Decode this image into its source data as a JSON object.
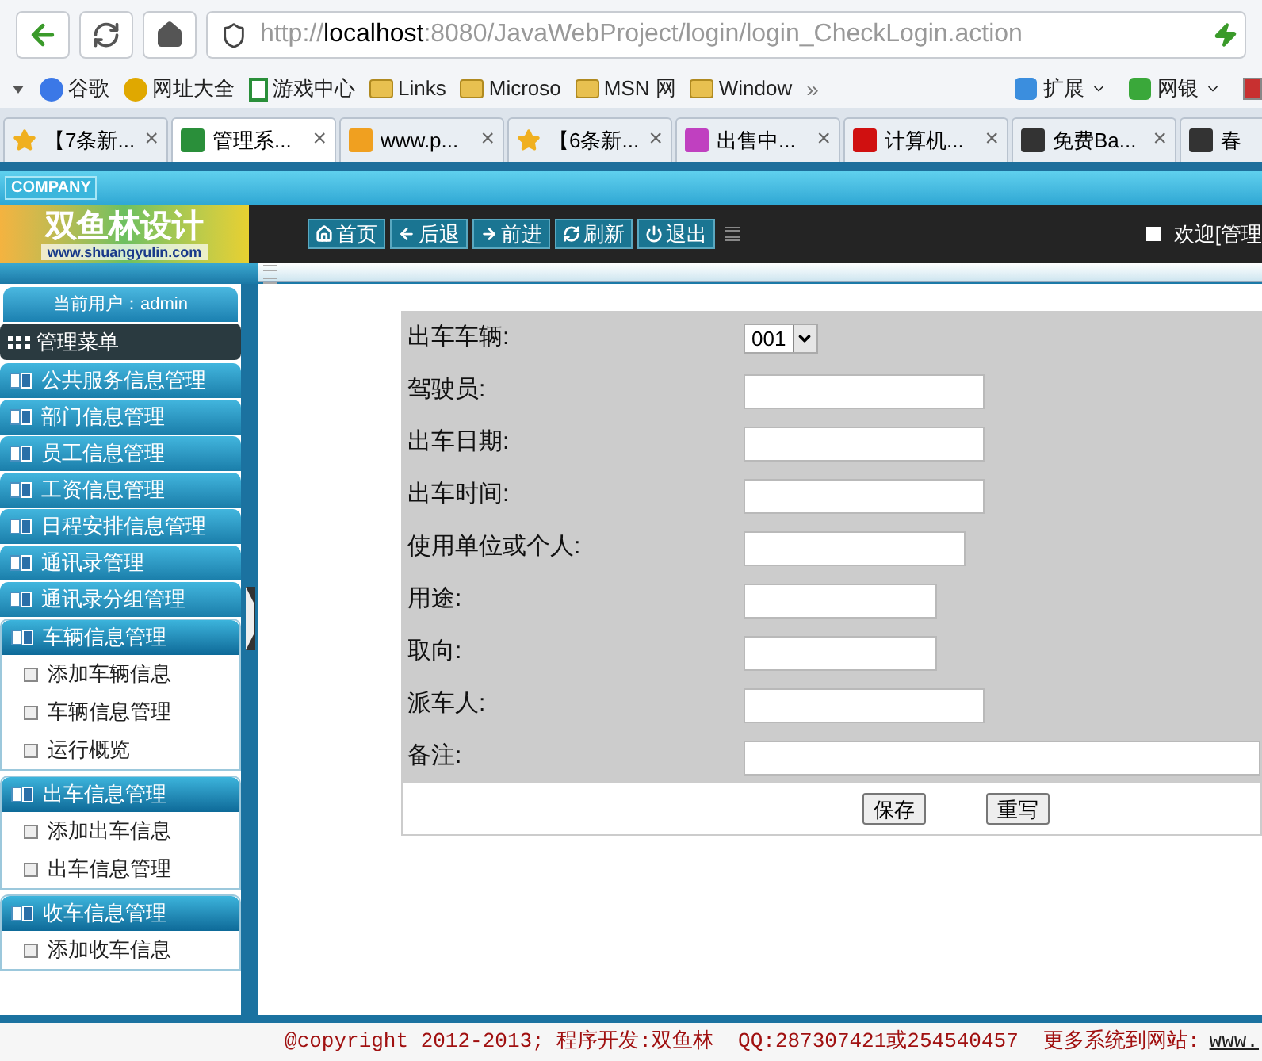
{
  "browser": {
    "address": "http://**localhost**:8080/JavaWebProject/login/login_CheckLogin.action",
    "bookmarks": [
      {
        "label": "谷歌",
        "kind": "site",
        "color": "#3b78e7"
      },
      {
        "label": "网址大全",
        "kind": "site",
        "color": "#e0a800"
      },
      {
        "label": "游戏中心",
        "kind": "page",
        "color": "#2a8f3a"
      },
      {
        "label": "Links",
        "kind": "folder",
        "color": "#e8c050"
      },
      {
        "label": "Microso",
        "kind": "folder",
        "color": "#e8c050"
      },
      {
        "label": "MSN 网",
        "kind": "folder",
        "color": "#e8c050"
      },
      {
        "label": "Window",
        "kind": "folder",
        "color": "#e8c050"
      }
    ],
    "more": "»",
    "tools": [
      {
        "label": "扩展",
        "color": "#3b8ede"
      },
      {
        "label": "网银",
        "color": "#3aa83a"
      }
    ],
    "tabs": [
      {
        "label": "【7条新...",
        "selected": false,
        "color": "#f0b020"
      },
      {
        "label": "管理系...",
        "selected": true,
        "color": "#2a8f3a"
      },
      {
        "label": "www.p...",
        "selected": false,
        "color": "#f0a020"
      },
      {
        "label": "【6条新...",
        "selected": false,
        "color": "#f0b020"
      },
      {
        "label": "出售中...",
        "selected": false,
        "color": "#c040c0"
      },
      {
        "label": "计算机...",
        "selected": false,
        "color": "#d01010"
      },
      {
        "label": "免费Ba...",
        "selected": false,
        "color": "#333333"
      },
      {
        "label": "春",
        "selected": false,
        "color": "#333333"
      }
    ],
    "close": "×"
  },
  "header": {
    "badge": "COMPANY",
    "logo_title": "双鱼林设计",
    "logo_url": "www.shuangyulin.com",
    "nav": [
      {
        "label": "首页",
        "kind": "home"
      },
      {
        "label": "后退",
        "kind": "back"
      },
      {
        "label": "前进",
        "kind": "forward"
      },
      {
        "label": "刷新",
        "kind": "refresh"
      },
      {
        "label": "退出",
        "kind": "exit"
      }
    ],
    "welcome": "欢迎[管理"
  },
  "sidebar": {
    "user": "当前用户：admin",
    "menu_title": "管理菜单",
    "groups": [
      {
        "label": "公共服务信息管理",
        "expanded": false
      },
      {
        "label": "部门信息管理",
        "expanded": false
      },
      {
        "label": "员工信息管理",
        "expanded": false
      },
      {
        "label": "工资信息管理",
        "expanded": false
      },
      {
        "label": "日程安排信息管理",
        "expanded": false
      },
      {
        "label": "通讯录管理",
        "expanded": false
      },
      {
        "label": "通讯录分组管理",
        "expanded": false
      },
      {
        "label": "车辆信息管理",
        "expanded": true,
        "children": [
          {
            "label": "添加车辆信息"
          },
          {
            "label": "车辆信息管理"
          },
          {
            "label": "运行概览"
          }
        ]
      },
      {
        "label": "出车信息管理",
        "expanded": true,
        "children": [
          {
            "label": "添加出车信息"
          },
          {
            "label": "出车信息管理"
          }
        ]
      },
      {
        "label": "收车信息管理",
        "expanded": true,
        "children": [
          {
            "label": "添加收车信息"
          }
        ]
      }
    ]
  },
  "form": {
    "fields": [
      {
        "label": "出车车辆:",
        "kind": "select",
        "value": "001"
      },
      {
        "label": "驾驶员:",
        "kind": "text"
      },
      {
        "label": "出车日期:",
        "kind": "text"
      },
      {
        "label": "出车时间:",
        "kind": "text"
      },
      {
        "label": "使用单位或个人:",
        "kind": "text"
      },
      {
        "label": "用途:",
        "kind": "text"
      },
      {
        "label": "取向:",
        "kind": "text"
      },
      {
        "label": "派车人:",
        "kind": "text"
      },
      {
        "label": "备注:",
        "kind": "text"
      }
    ],
    "buttons": [
      "保存",
      "重写"
    ]
  },
  "footer": {
    "text": "@copyright 2012-2013; 程序开发:双鱼林  QQ:287307421或254540457  更多系统到网站:",
    "link": "www."
  }
}
